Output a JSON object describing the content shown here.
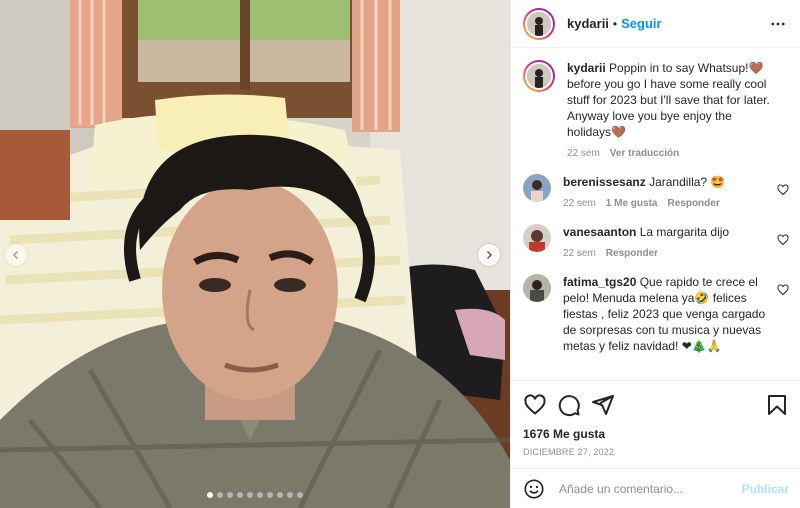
{
  "post": {
    "username": "kydarii",
    "follow_label": "Seguir",
    "separator": "•",
    "more_icon": "more-horizontal-icon",
    "caption": {
      "username": "kydarii",
      "text": "Poppin in to say Whatsup!🤎 before you go I have some really cool stuff for 2023 but I'll save that for later. Anyway love you bye enjoy the holidays🤎",
      "time": "22 sem",
      "translate_label": "Ver traducción"
    },
    "comments": [
      {
        "username": "berenissesanz",
        "text": "Jarandilla? 🤩",
        "time": "22 sem",
        "likes": "1 Me gusta",
        "reply": "Responder"
      },
      {
        "username": "vanesaanton",
        "text": "La margarita dijo",
        "time": "22 sem",
        "likes": "",
        "reply": "Responder"
      },
      {
        "username": "fatima_tgs20",
        "text": "Que rapido te crece el pelo! Menuda melena ya🤣 felices fiestas , feliz 2023 que venga cargado de sorpresas con tu musica y nuevas metas y feliz navidad! ❤🎄🙏",
        "time": "",
        "likes": "",
        "reply": ""
      }
    ],
    "likes_count": "1676 Me gusta",
    "date": "DICIEMBRE 27, 2022",
    "comment_placeholder": "Añade un comentario...",
    "publish_label": "Publicar",
    "carousel": {
      "total": 10,
      "active": 0
    },
    "colors": {
      "accent": "#0095f6",
      "publish_disabled": "#b2dffc",
      "muted": "#8e8e8e"
    }
  }
}
